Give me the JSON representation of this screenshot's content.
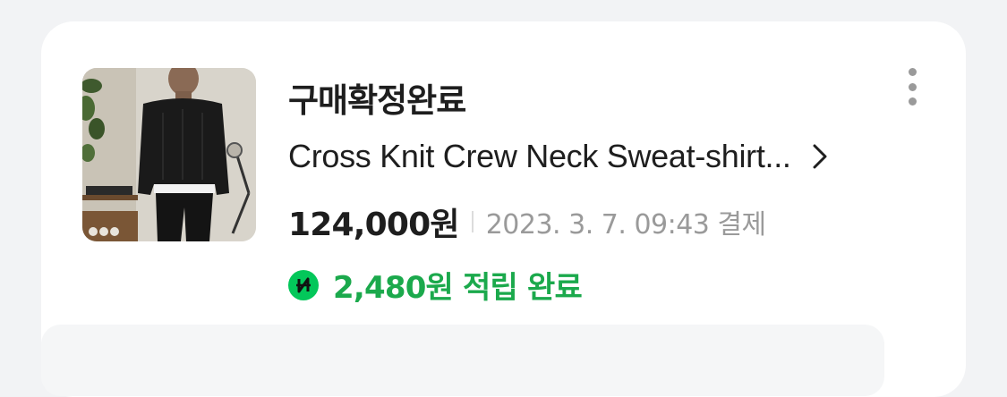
{
  "order": {
    "status": "구매확정완료",
    "product_name": "Cross Knit Crew Neck Sweat-shirt...",
    "price": "124,000원",
    "date": "2023. 3. 7. 09:43 결제",
    "points": "2,480원 적립 완료"
  },
  "icons": {
    "more": "more-vertical-icon",
    "chevron": "chevron-right-icon",
    "npay": "naver-pay-icon"
  },
  "colors": {
    "points_green": "#1ba94c",
    "npay_badge": "#03c75a"
  }
}
